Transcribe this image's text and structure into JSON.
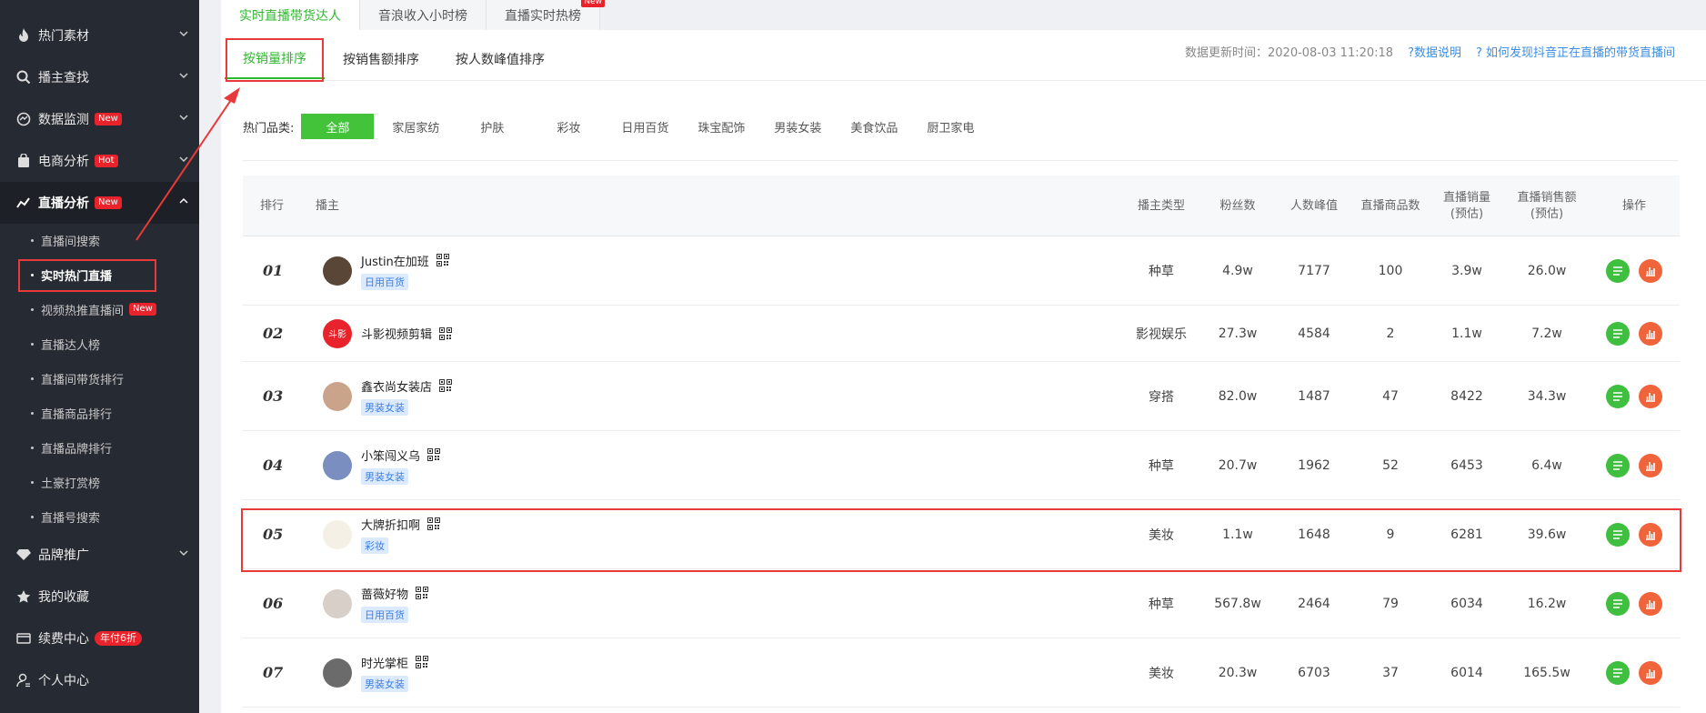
{
  "sidebar": {
    "items": [
      {
        "label": "热门素材",
        "icon": "fire-icon"
      },
      {
        "label": "播主查找",
        "icon": "search-icon"
      },
      {
        "label": "数据监测",
        "icon": "monitor-icon",
        "badge": "New"
      },
      {
        "label": "电商分析",
        "icon": "bag-icon",
        "badge": "Hot"
      },
      {
        "label": "直播分析",
        "icon": "trend-icon",
        "badge": "New"
      },
      {
        "label": "品牌推广",
        "icon": "diamond-icon"
      },
      {
        "label": "我的收藏",
        "icon": "star-icon"
      },
      {
        "label": "续费中心",
        "icon": "card-icon",
        "badge": "年付6折"
      },
      {
        "label": "个人中心",
        "icon": "user-icon"
      }
    ],
    "sub_items": [
      {
        "label": "直播间搜索"
      },
      {
        "label": "实时热门直播"
      },
      {
        "label": "视频热推直播间",
        "badge": "New"
      },
      {
        "label": "直播达人榜"
      },
      {
        "label": "直播间带货排行"
      },
      {
        "label": "直播商品排行"
      },
      {
        "label": "直播品牌排行"
      },
      {
        "label": "土豪打赏榜"
      },
      {
        "label": "直播号搜索"
      }
    ]
  },
  "top_tabs": [
    {
      "label": "实时直播带货达人"
    },
    {
      "label": "音浪收入小时榜"
    },
    {
      "label": "直播实时热榜",
      "badge": "New"
    }
  ],
  "sort_tabs": [
    {
      "label": "按销量排序"
    },
    {
      "label": "按销售额排序"
    },
    {
      "label": "按人数峰值排序"
    }
  ],
  "update_info": {
    "label": "数据更新时间：2020-08-03 11:20:18",
    "link1": "?数据说明",
    "link2": "? 如何发现抖音正在直播的带货直播间"
  },
  "categories": {
    "label": "热门品类:",
    "items": [
      "全部",
      "家居家纺",
      "护肤",
      "彩妆",
      "日用百货",
      "珠宝配饰",
      "男装女装",
      "美食饮品",
      "厨卫家电"
    ]
  },
  "table": {
    "headers": {
      "rank": "排行",
      "anchor": "播主",
      "type": "播主类型",
      "fans": "粉丝数",
      "peak": "人数峰值",
      "goods": "直播商品数",
      "sales": "直播销量\n(预估)",
      "amount": "直播销售额\n(预估)",
      "ops": "操作"
    },
    "rows": [
      {
        "rank": "01",
        "name": "Justin在加班",
        "tag": "日用百货",
        "type": "种草",
        "fans": "4.9w",
        "peak": "7177",
        "goods": "100",
        "sales": "3.9w",
        "amount": "26.0w",
        "avatar_color": "#5a4636"
      },
      {
        "rank": "02",
        "name": "斗影视频剪辑",
        "tag": "",
        "type": "影视娱乐",
        "fans": "27.3w",
        "peak": "4584",
        "goods": "2",
        "sales": "1.1w",
        "amount": "7.2w",
        "avatar_color": "#e8232b",
        "avatar_text": "斗影"
      },
      {
        "rank": "03",
        "name": "鑫衣尚女装店",
        "tag": "男装女装",
        "type": "穿搭",
        "fans": "82.0w",
        "peak": "1487",
        "goods": "47",
        "sales": "8422",
        "amount": "34.3w",
        "avatar_color": "#c9a48a"
      },
      {
        "rank": "04",
        "name": "小笨闯义乌",
        "tag": "男装女装",
        "type": "种草",
        "fans": "20.7w",
        "peak": "1962",
        "goods": "52",
        "sales": "6453",
        "amount": "6.4w",
        "avatar_color": "#7a8fbf"
      },
      {
        "rank": "05",
        "name": "大牌折扣啊",
        "tag": "彩妆",
        "type": "美妆",
        "fans": "1.1w",
        "peak": "1648",
        "goods": "9",
        "sales": "6281",
        "amount": "39.6w",
        "avatar_color": "#f5f0e6"
      },
      {
        "rank": "06",
        "name": "蔷薇好物",
        "tag": "日用百货",
        "type": "种草",
        "fans": "567.8w",
        "peak": "2464",
        "goods": "79",
        "sales": "6034",
        "amount": "16.2w",
        "avatar_color": "#d9cfc9"
      },
      {
        "rank": "07",
        "name": "时光掌柜",
        "tag": "男装女装",
        "type": "美妆",
        "fans": "20.3w",
        "peak": "6703",
        "goods": "37",
        "sales": "6014",
        "amount": "165.5w",
        "avatar_color": "#6b6b6b"
      }
    ]
  },
  "colors": {
    "accent": "#42c33a",
    "highlight": "#e83a3a",
    "sidebar": "#262a32"
  }
}
